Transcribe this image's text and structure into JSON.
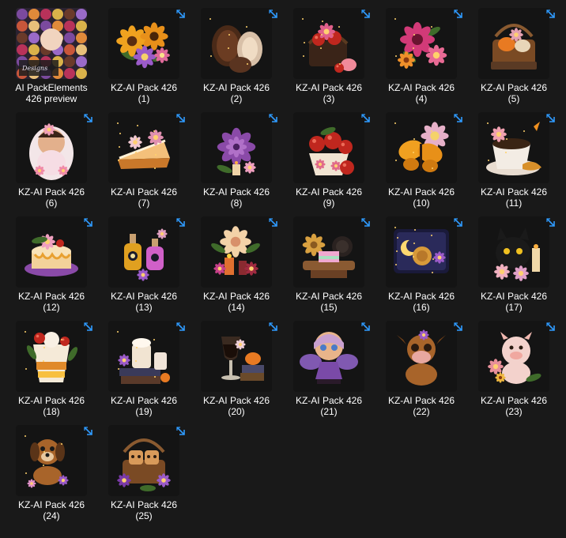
{
  "colors": {
    "background": "#191919",
    "text": "#ffffff",
    "shortcut_arrow": "#2f9bff"
  },
  "files": [
    {
      "line1": "AI PackElements",
      "line2": "426  preview",
      "icon": "preview-collage-icon",
      "theme": "collage",
      "shortcut": false
    },
    {
      "line1": "KZ-AI Pack 426",
      "line2": "(1)",
      "icon": "sunflower-bouquet-icon",
      "theme": "sunflower",
      "shortcut": true
    },
    {
      "line1": "KZ-AI Pack 426",
      "line2": "(2)",
      "icon": "pinecones-icon",
      "theme": "pinecone",
      "shortcut": true
    },
    {
      "line1": "KZ-AI Pack 426",
      "line2": "(3)",
      "icon": "fruit-basket-icon",
      "theme": "basket",
      "shortcut": true
    },
    {
      "line1": "KZ-AI Pack 426",
      "line2": "(4)",
      "icon": "pink-flowers-icon",
      "theme": "pinkflower",
      "shortcut": true
    },
    {
      "line1": "KZ-AI Pack 426",
      "line2": "(5)",
      "icon": "pumpkin-basket-icon",
      "theme": "pumpkinbasket",
      "shortcut": true
    },
    {
      "line1": "KZ-AI Pack 426",
      "line2": "(6)",
      "icon": "baby-doll-icon",
      "theme": "baby",
      "shortcut": true
    },
    {
      "line1": "KZ-AI Pack 426",
      "line2": "(7)",
      "icon": "pie-slice-icon",
      "theme": "pie",
      "shortcut": true
    },
    {
      "line1": "KZ-AI Pack 426",
      "line2": "(8)",
      "icon": "purple-rose-icon",
      "theme": "purplerose",
      "shortcut": true
    },
    {
      "line1": "KZ-AI Pack 426",
      "line2": "(9)",
      "icon": "apple-cup-icon",
      "theme": "applecup",
      "shortcut": true
    },
    {
      "line1": "KZ-AI Pack 426",
      "line2": "(10)",
      "icon": "butterfly-icon",
      "theme": "butterfly",
      "shortcut": true
    },
    {
      "line1": "KZ-AI Pack 426",
      "line2": "(11)",
      "icon": "coffee-cup-icon",
      "theme": "coffee",
      "shortcut": true
    },
    {
      "line1": "KZ-AI Pack 426",
      "line2": "(12)",
      "icon": "layer-cake-icon",
      "theme": "cake",
      "shortcut": true
    },
    {
      "line1": "KZ-AI Pack 426",
      "line2": "(13)",
      "icon": "potion-bottles-icon",
      "theme": "bottles",
      "shortcut": true
    },
    {
      "line1": "KZ-AI Pack 426",
      "line2": "(14)",
      "icon": "rose-candle-icon",
      "theme": "rosecandle",
      "shortcut": true
    },
    {
      "line1": "KZ-AI Pack 426",
      "line2": "(15)",
      "icon": "mooncakes-icon",
      "theme": "mooncakes",
      "shortcut": true
    },
    {
      "line1": "KZ-AI Pack 426",
      "line2": "(16)",
      "icon": "mooncake-tray-icon",
      "theme": "tray",
      "shortcut": true
    },
    {
      "line1": "KZ-AI Pack 426",
      "line2": "(17)",
      "icon": "black-cat-candles-icon",
      "theme": "cat",
      "shortcut": true
    },
    {
      "line1": "KZ-AI Pack 426",
      "line2": "(18)",
      "icon": "parfait-icon",
      "theme": "parfait",
      "shortcut": true
    },
    {
      "line1": "KZ-AI Pack 426",
      "line2": "(19)",
      "icon": "books-latte-icon",
      "theme": "books",
      "shortcut": true
    },
    {
      "line1": "KZ-AI Pack 426",
      "line2": "(20)",
      "icon": "wine-books-icon",
      "theme": "wine",
      "shortcut": true
    },
    {
      "line1": "KZ-AI Pack 426",
      "line2": "(21)",
      "icon": "fairy-girl-icon",
      "theme": "fairy",
      "shortcut": true
    },
    {
      "line1": "KZ-AI Pack 426",
      "line2": "(22)",
      "icon": "baby-cow-icon",
      "theme": "cow",
      "shortcut": true
    },
    {
      "line1": "KZ-AI Pack 426",
      "line2": "(23)",
      "icon": "piglet-icon",
      "theme": "pig",
      "shortcut": true
    },
    {
      "line1": "KZ-AI Pack 426",
      "line2": "(24)",
      "icon": "puppy-icon",
      "theme": "puppy",
      "shortcut": true
    },
    {
      "line1": "KZ-AI Pack 426",
      "line2": "(25)",
      "icon": "cookie-basket-icon",
      "theme": "cookiebasket",
      "shortcut": true
    }
  ]
}
